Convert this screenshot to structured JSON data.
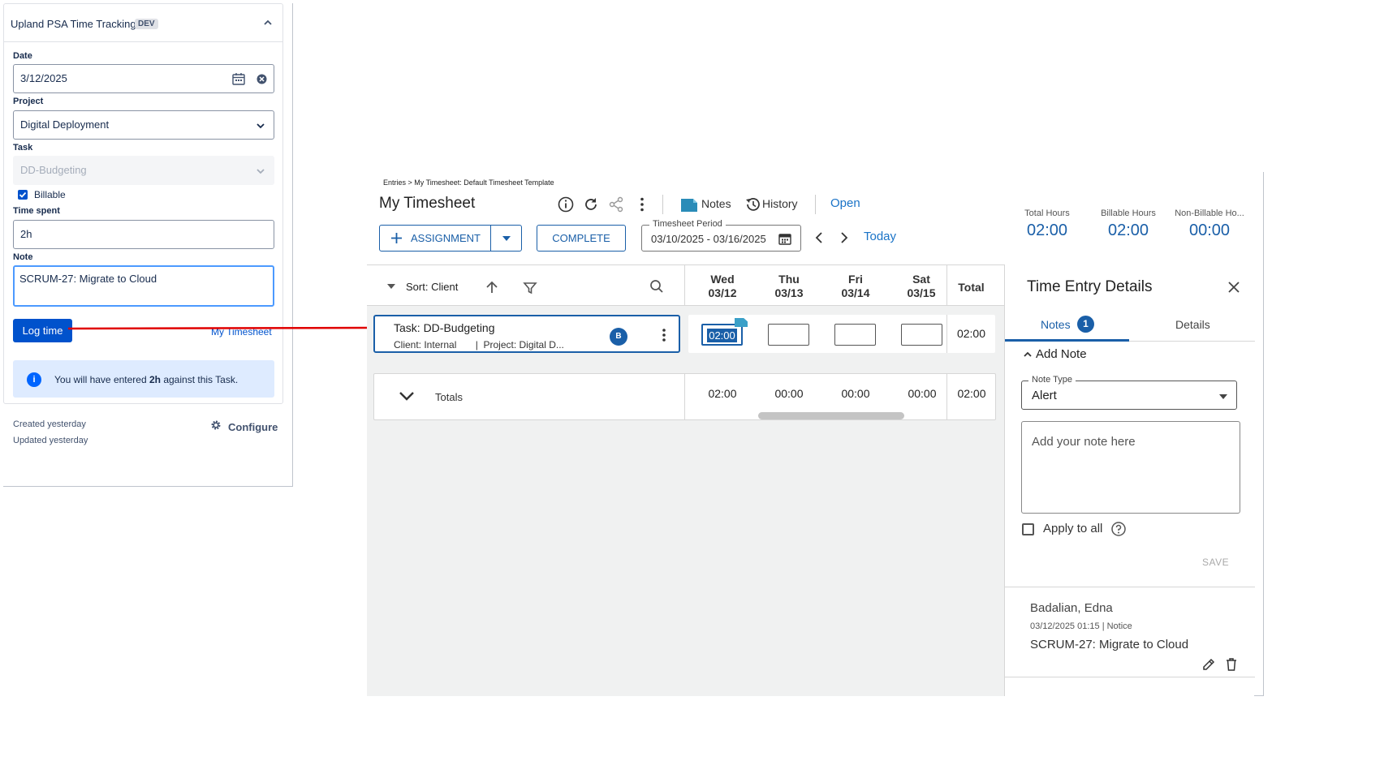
{
  "left_panel": {
    "title": "Upland PSA Time Tracking",
    "env_badge": "DEV",
    "date_label": "Date",
    "date_value": "3/12/2025",
    "project_label": "Project",
    "project_value": "Digital Deployment",
    "task_label": "Task",
    "task_value": "DD-Budgeting",
    "billable_label": "Billable",
    "billable_checked": true,
    "time_label": "Time spent",
    "time_value": "2h",
    "note_label": "Note",
    "note_value": "SCRUM-27: Migrate to Cloud",
    "log_button": "Log time",
    "timesheet_link": "My Timesheet",
    "info_prefix": "You will have entered ",
    "info_amount": "2h",
    "info_suffix": " against this Task.",
    "created": "Created yesterday",
    "updated": "Updated yesterday",
    "configure": "Configure"
  },
  "timesheet": {
    "breadcrumb": "Entries > My Timesheet: Default Timesheet Template",
    "title": "My Timesheet",
    "notes_label": "Notes",
    "history_label": "History",
    "status": "Open",
    "assignment_button": "ASSIGNMENT",
    "complete_button": "COMPLETE",
    "period_label": "Timesheet Period",
    "period_value": "03/10/2025 - 03/16/2025",
    "today": "Today",
    "kpis": [
      {
        "label": "Total Hours",
        "value": "02:00"
      },
      {
        "label": "Billable Hours",
        "value": "02:00"
      },
      {
        "label": "Non-Billable Ho...",
        "value": "00:00"
      }
    ],
    "sort_label": "Sort: Client",
    "days": [
      {
        "name": "Wed",
        "date": "03/12"
      },
      {
        "name": "Thu",
        "date": "03/13"
      },
      {
        "name": "Fri",
        "date": "03/14"
      },
      {
        "name": "Sat",
        "date": "03/15"
      }
    ],
    "total_header": "Total",
    "row": {
      "task": "Task: DD-Budgeting",
      "client": "Client: Internal",
      "project": "Project: Digital D...",
      "badge": "B",
      "cells": [
        "02:00",
        "",
        "",
        ""
      ],
      "total": "02:00"
    },
    "totals": {
      "label": "Totals",
      "values": [
        "02:00",
        "00:00",
        "00:00",
        "00:00"
      ],
      "total": "02:00"
    }
  },
  "details": {
    "title": "Time Entry Details",
    "tab_notes": "Notes",
    "notes_count": "1",
    "tab_details": "Details",
    "add_note": "Add Note",
    "note_type_label": "Note Type",
    "note_type_value": "Alert",
    "note_placeholder": "Add your note here",
    "apply_all": "Apply to all",
    "save": "SAVE",
    "entry_author": "Badalian, Edna",
    "entry_meta": "03/12/2025 01:15 | Notice",
    "entry_text": "SCRUM-27: Migrate to Cloud"
  },
  "colors": {
    "atlassian_blue": "#0052cc",
    "psa_blue": "#1a5fa8",
    "arrow_red": "#e00000"
  }
}
